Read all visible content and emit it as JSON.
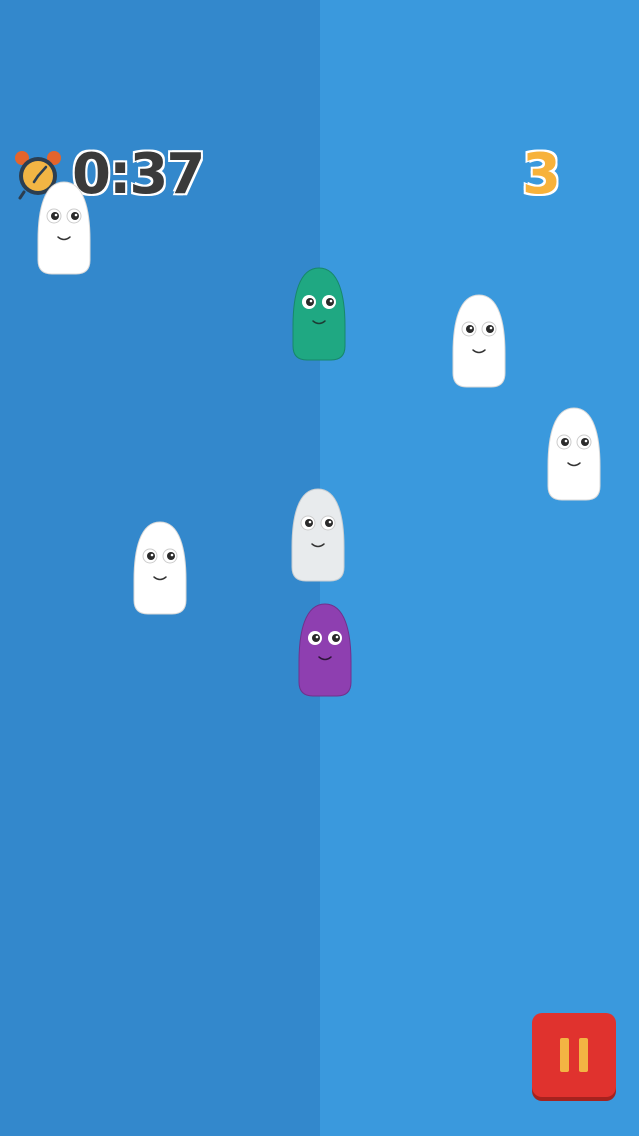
{
  "hud": {
    "timer": "0:37",
    "score": "3",
    "clock_icon": "alarm-clock-icon",
    "pause_icon": "pause-icon"
  },
  "colors": {
    "left_bg": "#3388CC",
    "right_bg": "#3A99DD",
    "white_blob": "#FFFFFF",
    "gray_blob": "#E8EBED",
    "green_blob": "#1FA882",
    "purple_blob": "#8E3FB0",
    "score": "#F7B23B",
    "pause_button": "#E0322E"
  },
  "blobs": [
    {
      "color": "white"
    },
    {
      "color": "green"
    },
    {
      "color": "white"
    },
    {
      "color": "white"
    },
    {
      "color": "white"
    },
    {
      "color": "gray"
    },
    {
      "color": "purple"
    }
  ]
}
